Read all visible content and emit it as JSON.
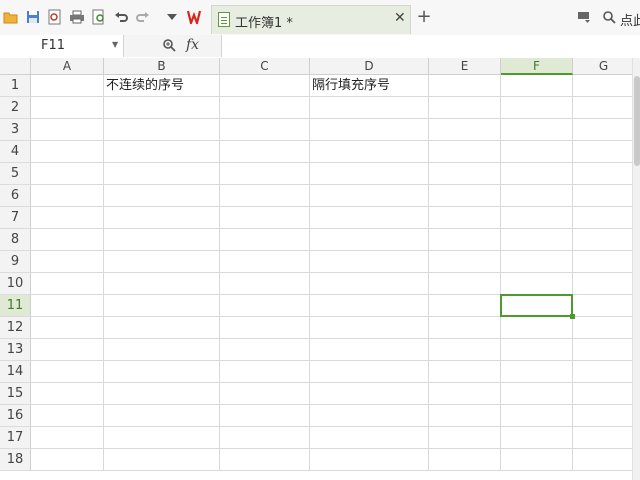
{
  "toolbar": {
    "icons": [
      "open-folder-icon",
      "save-icon",
      "export-pdf-icon",
      "print-icon",
      "print-preview-icon",
      "undo-icon",
      "redo-icon",
      "dropdown-icon",
      "wps-logo",
      "plus-icon",
      "filter-icon",
      "search-icon"
    ],
    "new_tab_symbol": "+",
    "tab": {
      "title": "工作簿1 *",
      "close_symbol": "✕"
    },
    "right_label": "点此"
  },
  "formula_bar": {
    "cell_reference": "F11",
    "fx_label": "fx",
    "formula": ""
  },
  "sheet": {
    "columns": [
      "A",
      "B",
      "C",
      "D",
      "E",
      "F",
      "G"
    ],
    "rows": [
      "1",
      "2",
      "3",
      "4",
      "5",
      "6",
      "7",
      "8",
      "9",
      "10",
      "11",
      "12",
      "13",
      "14",
      "15",
      "16",
      "17",
      "18"
    ],
    "active_column": "F",
    "active_row": "11",
    "cells": {
      "B1": "不连续的序号",
      "D1": "隔行填充序号"
    }
  },
  "colors": {
    "accent_green": "#4f9a2e",
    "tab_background": "#e7eee1",
    "wps_red": "#d7261b"
  }
}
